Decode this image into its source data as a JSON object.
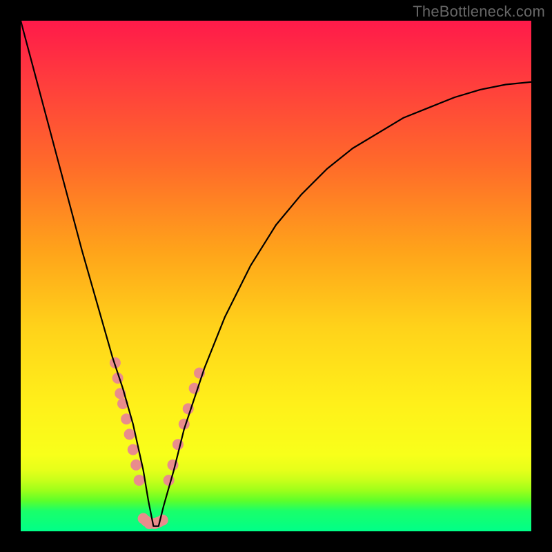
{
  "watermark": "TheBottleneck.com",
  "chart_data": {
    "type": "line",
    "title": "",
    "xlabel": "",
    "ylabel": "",
    "xlim": [
      0,
      100
    ],
    "ylim": [
      0,
      100
    ],
    "grid": false,
    "legend": false,
    "description": "Bottleneck curve: V-shaped curve showing bottleneck percentage across a parameter sweep. The curve dips to ~0 near x≈26 (balanced point) and rises toward 100 at both extremes. Pink dots highlight the near-balanced segment around the minimum.",
    "series": [
      {
        "name": "bottleneck-curve",
        "x": [
          0,
          4,
          8,
          12,
          16,
          18,
          20,
          22,
          24,
          25,
          26,
          27,
          28,
          30,
          32,
          34,
          36,
          40,
          45,
          50,
          55,
          60,
          65,
          70,
          75,
          80,
          85,
          90,
          95,
          100
        ],
        "y": [
          100,
          85,
          70,
          55,
          41,
          34,
          28,
          21,
          12,
          6,
          1,
          1,
          5,
          12,
          20,
          26,
          32,
          42,
          52,
          60,
          66,
          71,
          75,
          78,
          81,
          83,
          85,
          86.5,
          87.5,
          88
        ]
      }
    ],
    "highlight_points": {
      "name": "near-balanced-dots",
      "color": "#e98c8c",
      "radius_px": 8,
      "points": [
        {
          "x": 18.5,
          "y": 33
        },
        {
          "x": 19.0,
          "y": 30
        },
        {
          "x": 19.5,
          "y": 27
        },
        {
          "x": 20.0,
          "y": 25
        },
        {
          "x": 20.7,
          "y": 22
        },
        {
          "x": 21.3,
          "y": 19
        },
        {
          "x": 22.0,
          "y": 16
        },
        {
          "x": 22.6,
          "y": 13
        },
        {
          "x": 23.2,
          "y": 10
        },
        {
          "x": 24.0,
          "y": 2.5
        },
        {
          "x": 24.6,
          "y": 2
        },
        {
          "x": 25.2,
          "y": 1.5
        },
        {
          "x": 26.2,
          "y": 1.5
        },
        {
          "x": 27.0,
          "y": 1.8
        },
        {
          "x": 27.8,
          "y": 2.2
        },
        {
          "x": 29.0,
          "y": 10
        },
        {
          "x": 29.8,
          "y": 13
        },
        {
          "x": 30.8,
          "y": 17
        },
        {
          "x": 32.0,
          "y": 21
        },
        {
          "x": 32.8,
          "y": 24
        },
        {
          "x": 34.0,
          "y": 28
        },
        {
          "x": 35.0,
          "y": 31
        }
      ]
    }
  }
}
